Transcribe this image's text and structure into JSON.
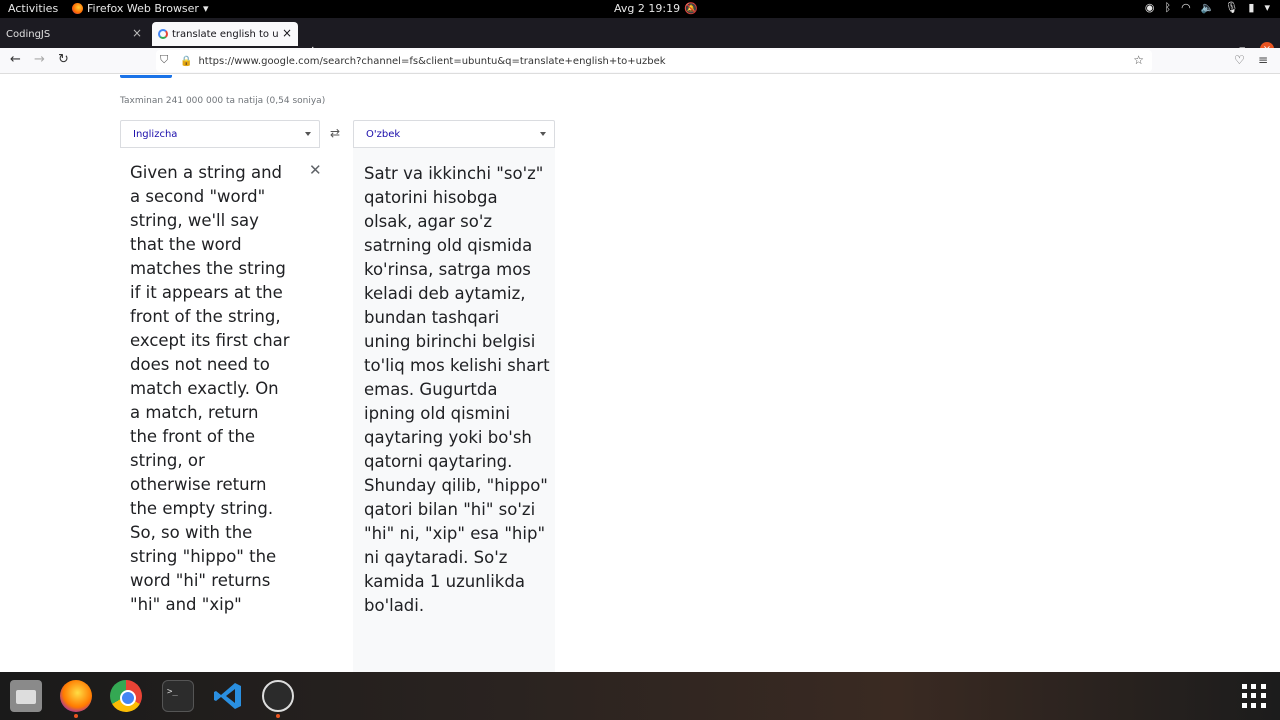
{
  "topbar": {
    "activities": "Activities",
    "app_menu": "Firefox Web Browser",
    "clock": "Avg 2  19:19"
  },
  "tabs": [
    {
      "title": "CodingJS"
    },
    {
      "title": "translate english to uzbek"
    }
  ],
  "navbar": {
    "url": "https://www.google.com/search?channel=fs&client=ubuntu&q=translate+english+to+uzbek"
  },
  "page": {
    "results_count": "Taxminan 241 000 000 ta natija (0,54 soniya)",
    "source_language": "Inglizcha",
    "target_language": "O'zbek",
    "source_text": "Given a string and a second \"word\" string, we'll say that the word matches the string if it appears at the front of the string, except its first char does not need to match exactly. On a match, return the front of the string, or otherwise return the empty string. So, so with the string \"hippo\" the word \"hi\" returns \"hi\" and \"xip\"",
    "translated_text": "Satr va ikkinchi \"so'z\" qatorini hisobga olsak, agar so'z satrning old qismida ko'rinsa, satrga mos keladi deb aytamiz, bundan tashqari uning birinchi belgisi to'liq mos kelishi shart emas. Gugurtda ipning old qismini qaytaring yoki bo'sh qatorni qaytaring. Shunday qilib, \"hippo\" qatori bilan \"hi\" so'zi \"hi\" ni, \"xip\" esa \"hip\" ni qaytaradi. So'z kamida 1 uzunlikda bo'ladi."
  },
  "colors": {
    "link_blue": "#1a0dab",
    "accent_blue": "#1a73e8",
    "ubuntu_orange": "#e95420"
  },
  "icons": {
    "close": "close-icon",
    "swap": "swap-icon",
    "lock": "lock-icon",
    "star": "bookmark-star-icon"
  }
}
